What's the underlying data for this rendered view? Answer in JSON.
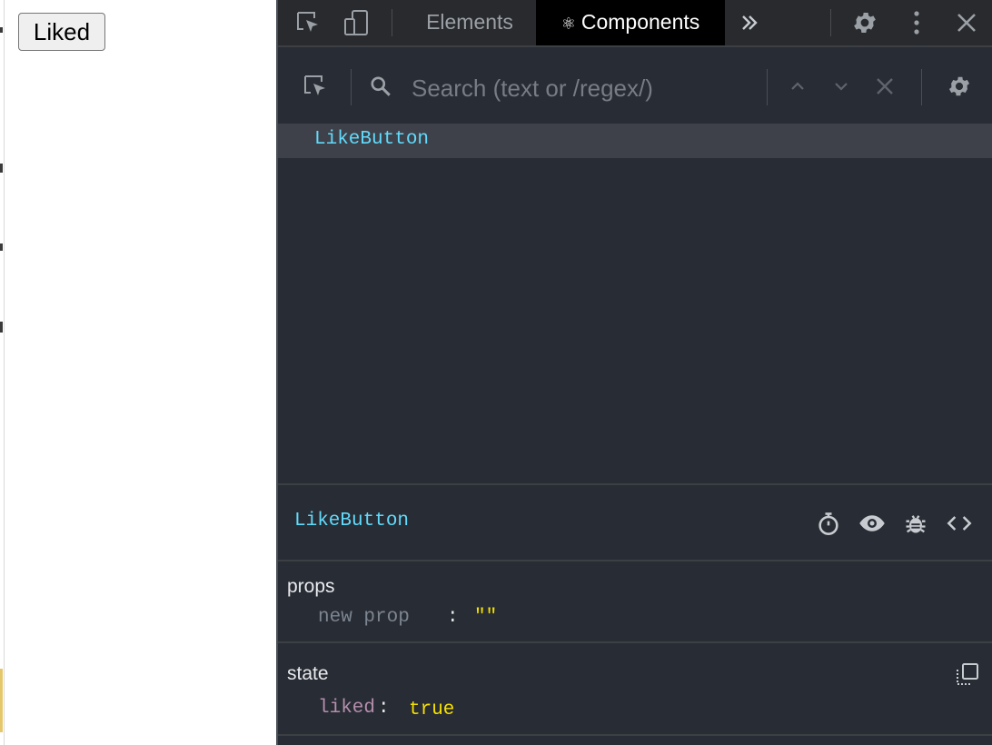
{
  "page": {
    "button_label": "Liked"
  },
  "devtools": {
    "tabs": [
      {
        "label": "Elements",
        "active": false
      },
      {
        "label": "Components",
        "active": true,
        "icon": "react-atom-icon"
      }
    ],
    "toolbar_icons": [
      "inspect-element-icon",
      "device-toggle-icon",
      "more-tabs-icon",
      "settings-gear-icon",
      "kebab-menu-icon",
      "close-icon"
    ],
    "search": {
      "placeholder": "Search (text or /regex/)",
      "value": ""
    },
    "tree": {
      "rows": [
        {
          "label": "LikeButton",
          "selected": true
        }
      ]
    },
    "inspector": {
      "component_name": "LikeButton",
      "header_icons": [
        "stopwatch-icon",
        "eye-icon",
        "bug-icon",
        "code-icon"
      ],
      "props": {
        "title": "props",
        "new_prop_key": "new prop",
        "colon": ":",
        "new_prop_value": "\"\""
      },
      "state": {
        "title": "state",
        "key": "liked",
        "colon": ":",
        "value": "true"
      }
    },
    "colors": {
      "background": "#282c34",
      "component_name": "#61dafb",
      "string_value": "#f5e000",
      "state_key": "#b48ead"
    }
  }
}
